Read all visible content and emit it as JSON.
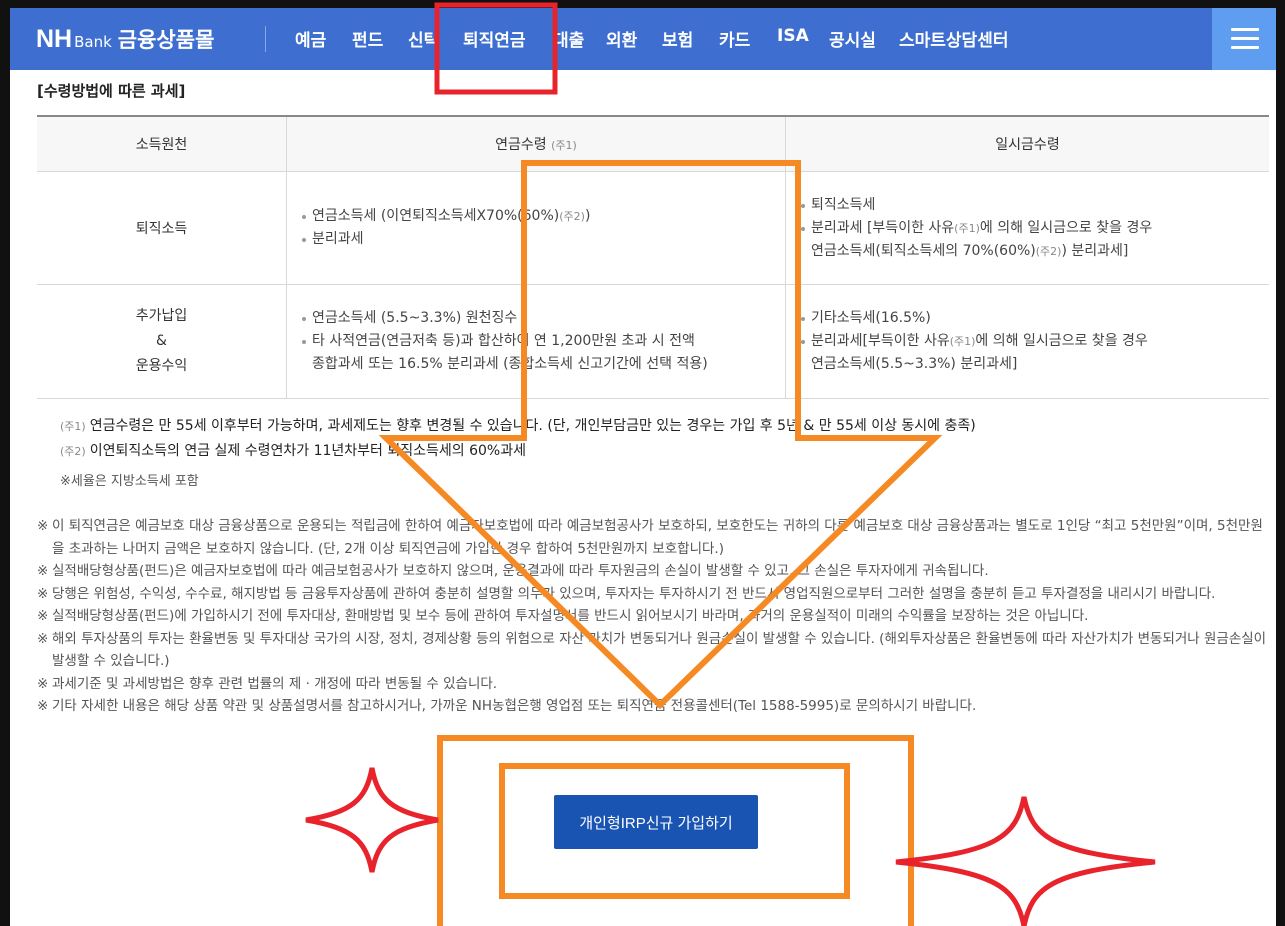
{
  "header": {
    "logo_nh": "NH",
    "logo_bank": "Bank",
    "logo_mall": "금융상품몰",
    "nav": [
      "예금",
      "펀드",
      "신탁",
      "퇴직연금",
      "대출",
      "외환",
      "보험",
      "카드",
      "ISA",
      "공시실",
      "스마트상담센터"
    ],
    "menu_icon": "hamburger-icon"
  },
  "section_title": "[수령방법에 따른 과세]",
  "table": {
    "headers": {
      "source": "소득원천",
      "pension": "연금수령",
      "pension_note": "(주1)",
      "lump": "일시금수령"
    },
    "row1": {
      "label": "퇴직소득",
      "pension_1": "연금소득세 (이연퇴직소득세X70%(60%)",
      "pension_1_note": "(주2)",
      "pension_1_end": ")",
      "pension_2": "분리과세",
      "lump_1": "퇴직소득세",
      "lump_2_a": "분리과세 [부득이한 사유",
      "lump_2_note": "(주1)",
      "lump_2_b": "에 의해 일시금으로 찾을 경우",
      "lump_3_a": "연금소득세(퇴직소득세의 70%(60%)",
      "lump_3_note": "(주2)",
      "lump_3_b": ") 분리과세]"
    },
    "row2": {
      "label_1": "추가납입",
      "label_2": "&",
      "label_3": "운용수익",
      "pension_1": "연금소득세 (5.5~3.3%) 원천징수",
      "pension_2": "타 사적연금(연금저축 등)과 합산하여 연 1,200만원 초과 시 전액",
      "pension_3": "종합과세 또는 16.5% 분리과세 (종합소득세 신고기간에 선택 적용)",
      "lump_1": "기타소득세(16.5%)",
      "lump_2_a": "분리과세[부득이한 사유",
      "lump_2_note": "(주1)",
      "lump_2_b": "에 의해 일시금으로 찾을 경우",
      "lump_3": "연금소득세(5.5~3.3%) 분리과세]"
    }
  },
  "notes": {
    "n1_mark": "(주1)",
    "n1": "연금수령은 만 55세 이후부터 가능하며, 과세제도는 향후 변경될 수 있습니다. (단, 개인부담금만 있는 경우는 가입 후 5년 & 만 55세 이상 동시에 충족)",
    "n2_mark": "(주2)",
    "n2": "이연퇴직소득의 연금 실제 수령연차가 11년차부터 퇴직소득세의 60%과세",
    "tax_note": "※세율은 지방소득세 포함"
  },
  "disclaimers": [
    "이 퇴직연금은 예금보호 대상 금융상품으로 운용되는 적립금에 한하여 예금자보호법에 따라 예금보험공사가 보호하되, 보호한도는 귀하의 다른 예금보호 대상 금융상품과는 별도로 1인당 “최고 5천만원”이며, 5천만원을 초과하는 나머지 금액은 보호하지 않습니다. (단, 2개 이상 퇴직연금에 가입한 경우 합하여 5천만원까지 보호합니다.)",
    "실적배당형상품(펀드)은 예금자보호법에 따라 예금보험공사가 보호하지 않으며, 운용결과에 따라 투자원금의 손실이 발생할 수 있고, 그 손실은 투자자에게 귀속됩니다.",
    "당행은 위험성, 수익성, 수수료, 해지방법 등 금융투자상품에 관하여 충분히 설명할 의무가 있으며, 투자자는 투자하시기 전 반드시 영업직원으로부터 그러한 설명을 충분히 듣고 투자결정을 내리시기 바랍니다.",
    "실적배당형상품(펀드)에 가입하시기 전에 투자대상, 환매방법 및 보수 등에 관하여 투자설명서를 반드시 읽어보시기 바라며, 과거의 운용실적이 미래의 수익률을 보장하는 것은 아닙니다.",
    "해외 투자상품의 투자는 환율변동 및 투자대상 국가의 시장, 정치, 경제상황 등의 위험으로 자산 가치가 변동되거나 원금손실이 발생할 수 있습니다. (해외투자상품은 환율변동에 따라 자산가치가 변동되거나 원금손실이 발생할 수 있습니다.)",
    "과세기준 및 과세방법은 향후 관련 법률의 제 · 개정에 따라 변동될 수 있습니다.",
    "기타 자세한 내용은 해당 상품 약관 및 상품설명서를 참고하시거나, 가까운 NH농협은행 영업점 또는 퇴직연금 전용콜센터(Tel 1588-5995)로 문의하시기 바랍니다."
  ],
  "disclaimer_mark": "※",
  "cta": {
    "label": "개인형IRP신규 가입하기"
  },
  "annotation_colors": {
    "red": "#e8232b",
    "orange": "#f58a24",
    "nav_blue": "#3e6fd0",
    "button_blue": "#1a54b3"
  }
}
